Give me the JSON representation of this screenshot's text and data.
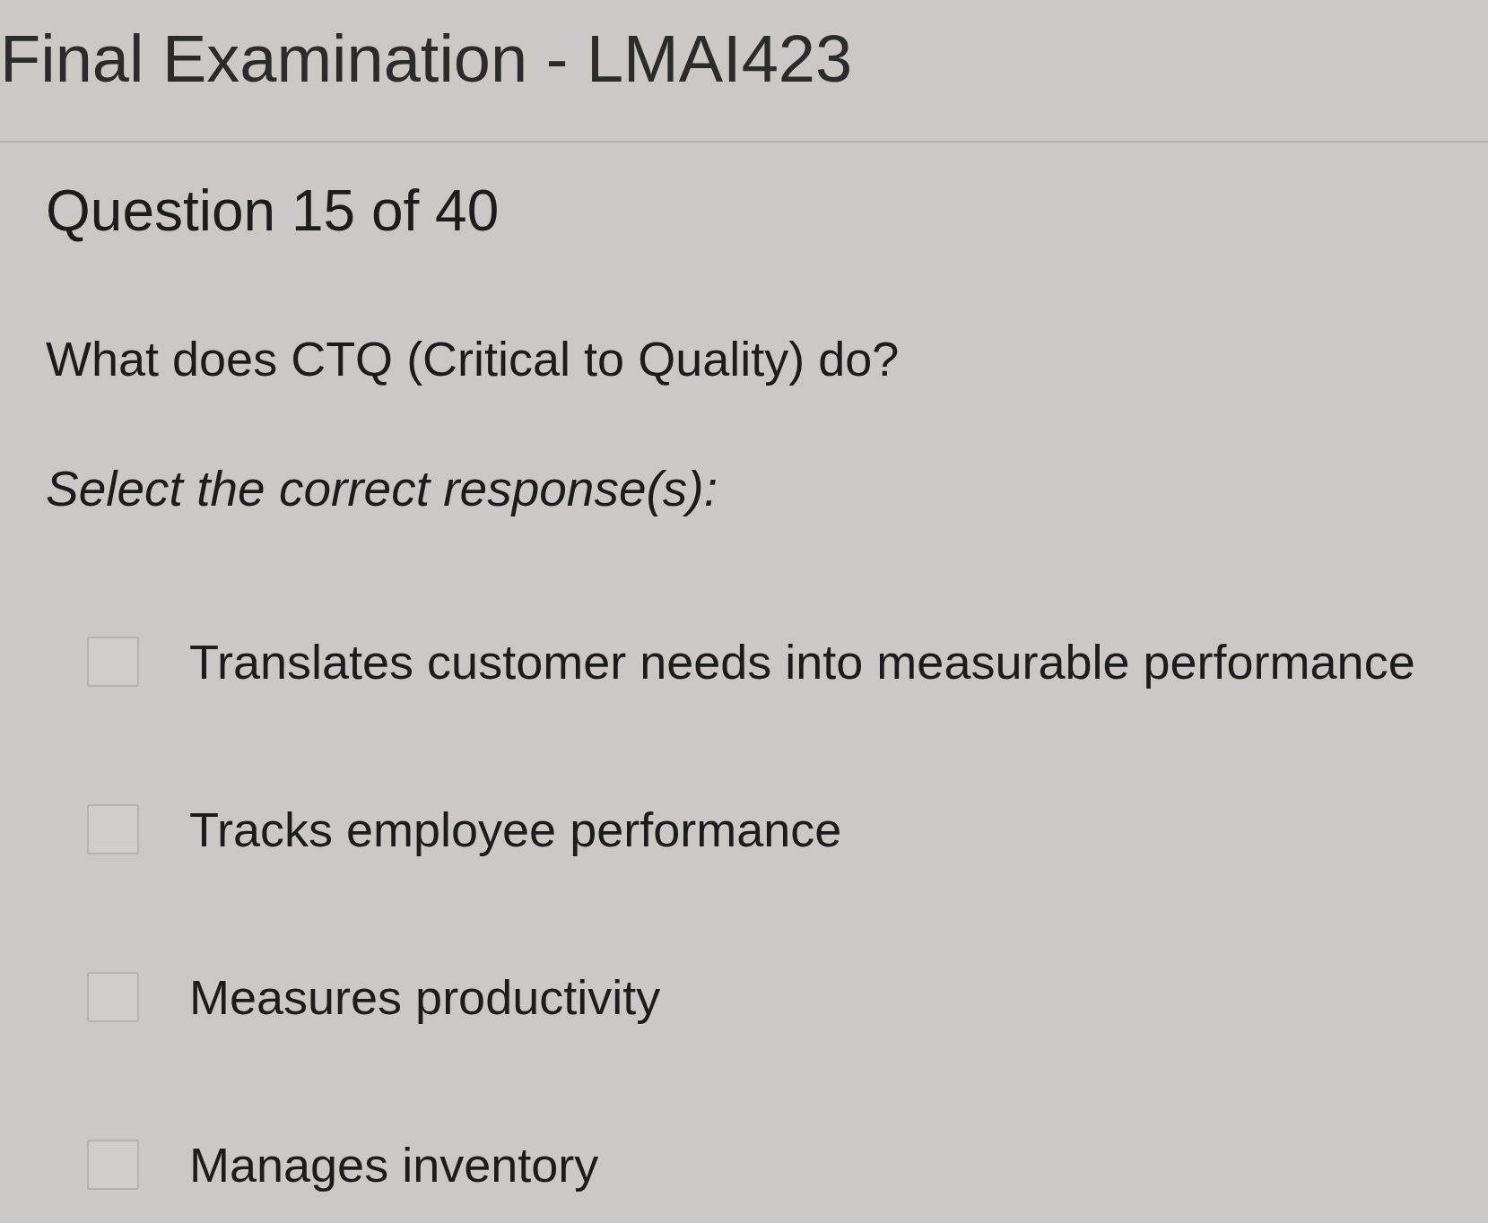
{
  "exam": {
    "title": "Final Examination - LMAI423"
  },
  "question": {
    "counter": "Question 15 of 40",
    "text": "What does CTQ (Critical to Quality) do?",
    "prompt": "Select the correct response(s):"
  },
  "options": [
    {
      "label": "Translates customer needs into measurable performance",
      "checked": false
    },
    {
      "label": "Tracks employee performance",
      "checked": false
    },
    {
      "label": "Measures productivity",
      "checked": false
    },
    {
      "label": "Manages inventory",
      "checked": false
    }
  ]
}
